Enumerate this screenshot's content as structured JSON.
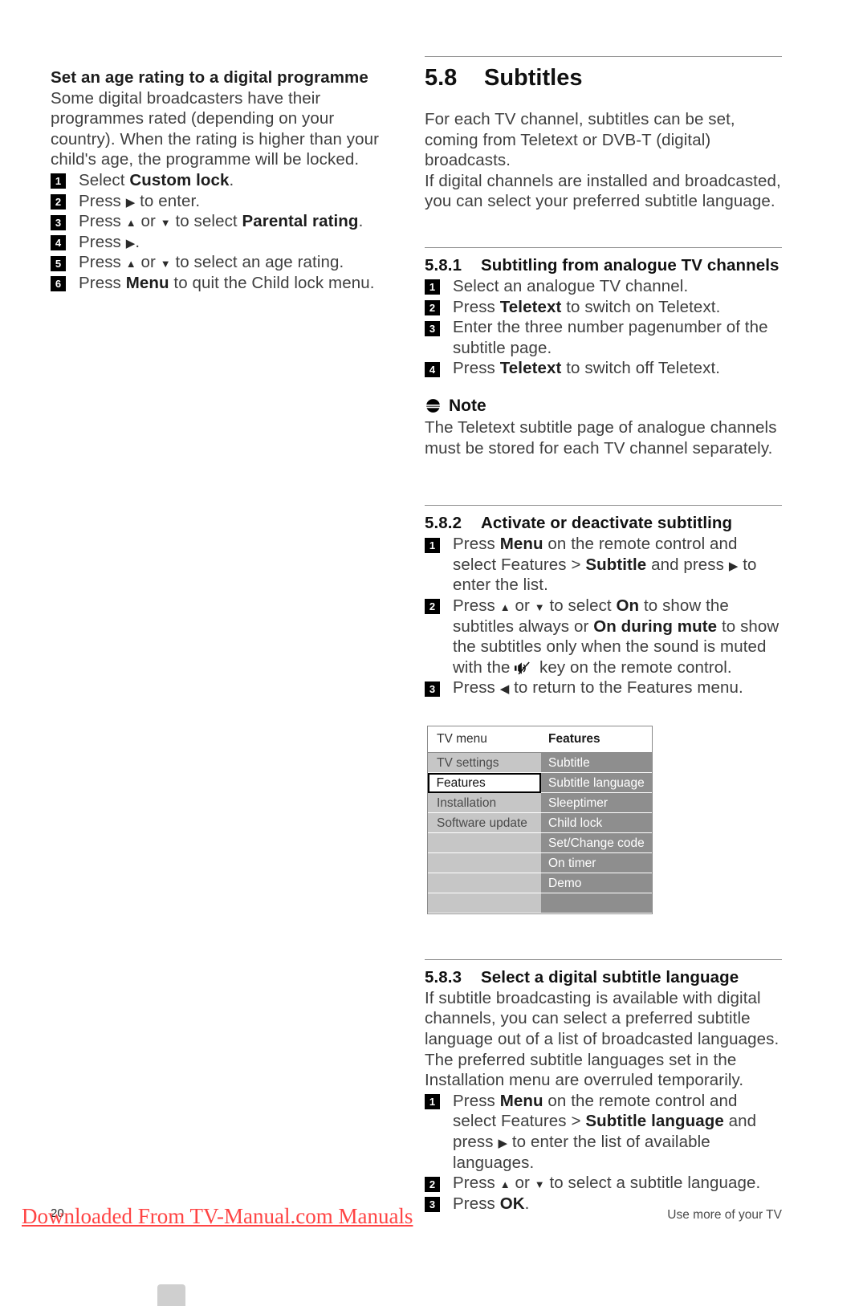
{
  "left_column": {
    "heading": "Set an age rating to a digital programme",
    "paragraph": "Some digital broadcasters have their programmes rated (depending on your country). When the rating is higher than your child's age, the programme will be locked.",
    "steps": [
      {
        "n": "1",
        "html": "Select <b>Custom lock</b>."
      },
      {
        "n": "2",
        "html": "Press <span class=\"arrow\">&#9654;</span> to enter."
      },
      {
        "n": "3",
        "html": "Press <span class=\"arrow arrow-up\">&#9650;</span> or <span class=\"arrow arrow-up\">&#9660;</span> to select <b>Parental rating</b>."
      },
      {
        "n": "4",
        "html": "Press <span class=\"arrow\">&#9654;</span>."
      },
      {
        "n": "5",
        "html": "Press <span class=\"arrow arrow-up\">&#9650;</span> or <span class=\"arrow arrow-up\">&#9660;</span> to select an age rating."
      },
      {
        "n": "6",
        "html": "Press <b>Menu</b> to quit the Child lock menu."
      }
    ]
  },
  "section": {
    "number": "5.8",
    "title": "Subtitles",
    "intro_line_1": "For each TV channel, subtitles can be set, coming from Teletext or DVB-T (digital) broadcasts.",
    "intro_line_2": "If digital channels are installed and broadcasted, you can select your preferred subtitle language."
  },
  "sub_581": {
    "number": "5.8.1",
    "title": "Subtitling from analogue TV channels",
    "steps": [
      {
        "n": "1",
        "html": "Select an analogue TV channel."
      },
      {
        "n": "2",
        "html": "Press <b>Teletext</b> to switch on Teletext."
      },
      {
        "n": "3",
        "html": "Enter the three number pagenumber of the subtitle page."
      },
      {
        "n": "4",
        "html": "Press <b>Teletext</b> to switch off Teletext."
      }
    ],
    "note": {
      "label": "Note",
      "icon": "note-icon",
      "text": "The Teletext subtitle page of analogue channels must be stored for each TV channel separately."
    }
  },
  "sub_582": {
    "number": "5.8.2",
    "title": "Activate or deactivate subtitling",
    "steps": [
      {
        "n": "1",
        "html": "Press <b>Menu</b> on the remote control and select Features &gt; <b>Subtitle</b> and press <span class=\"arrow\">&#9654;</span> to enter the list."
      },
      {
        "n": "2",
        "html": "Press <span class=\"arrow arrow-up\">&#9650;</span> or <span class=\"arrow arrow-up\">&#9660;</span> to select <b>On</b> to show the subtitles always or <b>On during mute</b> to show the subtitles only when the sound is muted with the <span class=\"mute-key\" data-name=\"mute-icon\"></span> key on the remote control."
      },
      {
        "n": "3",
        "html": "Press <span class=\"arrow\">&#9664;</span> to return to the Features menu."
      }
    ]
  },
  "tv_menu_figure": {
    "header": {
      "left": "TV menu",
      "right": "Features"
    },
    "left_items": [
      {
        "label": "TV settings",
        "selected": false
      },
      {
        "label": "Features",
        "selected": true
      },
      {
        "label": "Installation",
        "selected": false
      },
      {
        "label": "Software update",
        "selected": false
      },
      {
        "label": "",
        "selected": false
      },
      {
        "label": "",
        "selected": false
      },
      {
        "label": "",
        "selected": false
      },
      {
        "label": "",
        "selected": false
      }
    ],
    "right_items": [
      "Subtitle",
      "Subtitle language",
      "Sleeptimer",
      "Child lock",
      "Set/Change code",
      "On timer",
      "Demo",
      ""
    ],
    "colors": {
      "left_cell": "#c6c6c6",
      "right_cell": "#8e8e8e",
      "selected_border": "#000000",
      "border": "#8a8a8a"
    }
  },
  "sub_583": {
    "number": "5.8.3",
    "title": "Select a digital subtitle language",
    "paragraph": "If subtitle broadcasting is available with digital channels, you can select a preferred subtitle language out of a list of broadcasted languages. The preferred subtitle languages set in the Installation menu are overruled temporarily.",
    "steps": [
      {
        "n": "1",
        "html": "Press <b>Menu</b> on the remote control and select Features &gt; <b>Subtitle language</b> and press <span class=\"arrow\">&#9654;</span> to enter the list of available languages."
      },
      {
        "n": "2",
        "html": "Press <span class=\"arrow arrow-up\">&#9650;</span> or <span class=\"arrow arrow-up\">&#9660;</span> to select a subtitle language."
      },
      {
        "n": "3",
        "html": "Press <b>OK</b>."
      }
    ]
  },
  "footer": {
    "page_number": "20",
    "right_text": "Use more of your TV",
    "watermark": "Downloaded From TV-Manual.com Manuals",
    "watermark_color": "#ff4444"
  }
}
